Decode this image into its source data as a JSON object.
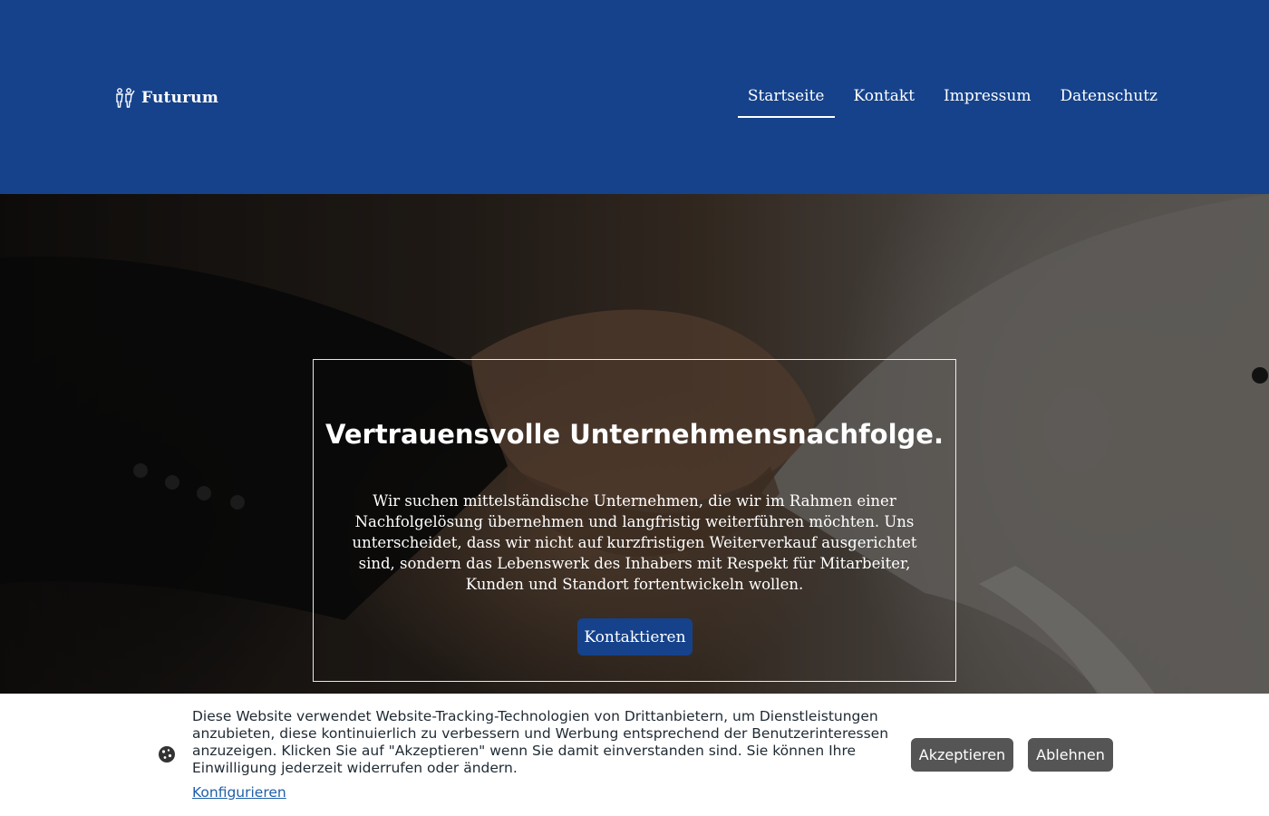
{
  "brand": {
    "name": "Futurum",
    "logo_icon": "people-logo-icon"
  },
  "nav": {
    "items": [
      {
        "label": "Startseite",
        "active": true
      },
      {
        "label": "Kontakt",
        "active": false
      },
      {
        "label": "Impressum",
        "active": false
      },
      {
        "label": "Datenschutz",
        "active": false
      }
    ]
  },
  "hero": {
    "title": "Vertrauensvolle Unternehmensnachfolge.",
    "text": "Wir suchen mittelständische Unternehmen, die wir im Rahmen einer Nachfolgelösung übernehmen und langfristig weiterführen möchten. Uns unterscheidet, dass wir nicht auf kurzfristigen Weiterverkauf ausgerichtet sind, sondern das Lebenswerk des Inhabers mit Respekt für Mitarbeiter, Kunden und Standort fortentwickeln wollen.",
    "button_label": "Kontaktieren",
    "background_image": "handshake"
  },
  "cookie_banner": {
    "icon": "cookie-icon",
    "text": "Diese Website verwendet Website-Tracking-Technologien von Drittanbietern, um Dienstleistungen anzubieten, diese kontinuierlich zu verbessern und Werbung entsprechend der Benutzerinteressen anzuzeigen. Klicken Sie auf \"Akzeptieren\" wenn Sie damit einverstanden sind. Sie können Ihre Einwilligung jederzeit widerrufen oder ändern.",
    "configure_label": "Konfigurieren",
    "accept_label": "Akzeptieren",
    "decline_label": "Ablehnen"
  },
  "colors": {
    "header_bg": "#15428b",
    "button_bg": "#15428b",
    "cookie_button_bg": "#555555",
    "link": "#1f5fa8"
  }
}
